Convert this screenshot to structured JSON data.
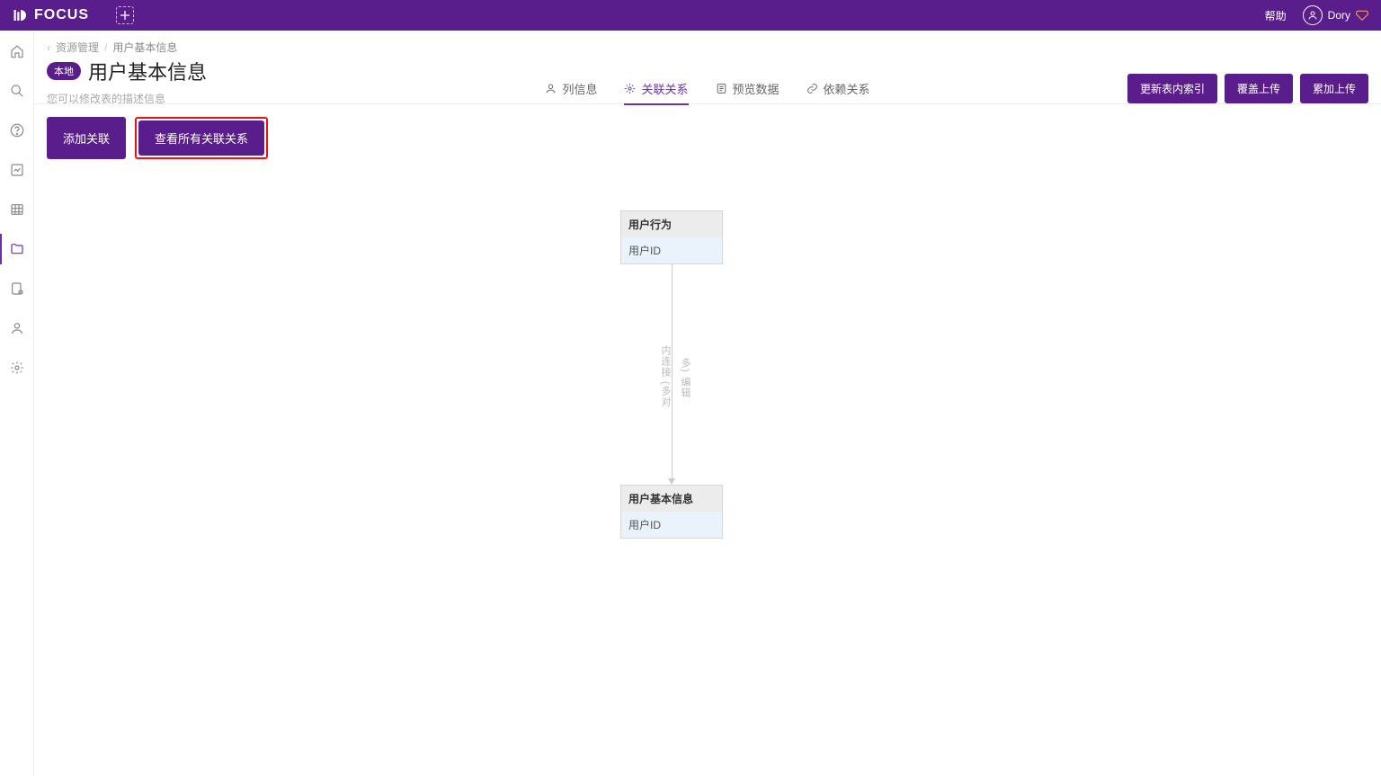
{
  "brand": "FOCUS",
  "topbar": {
    "help": "帮助",
    "username": "Dory"
  },
  "breadcrumb": {
    "back_icon": "‹",
    "parent": "资源管理",
    "current": "用户基本信息"
  },
  "page": {
    "badge": "本地",
    "title": "用户基本信息",
    "subtitle": "您可以修改表的描述信息"
  },
  "tabs": {
    "columns": "列信息",
    "relations": "关联关系",
    "preview": "预览数据",
    "deps": "依赖关系"
  },
  "actions": {
    "reindex": "更新表内索引",
    "overwrite": "覆盖上传",
    "append": "累加上传"
  },
  "toolbar": {
    "add_relation": "添加关联",
    "view_all": "查看所有关联关系"
  },
  "diagram": {
    "nodeA": {
      "title": "用户行为",
      "col": "用户ID"
    },
    "nodeB": {
      "title": "用户基本信息",
      "col": "用户ID"
    },
    "edge_label_left": "内连接 (多对",
    "edge_label_right": "多) 编辑"
  }
}
